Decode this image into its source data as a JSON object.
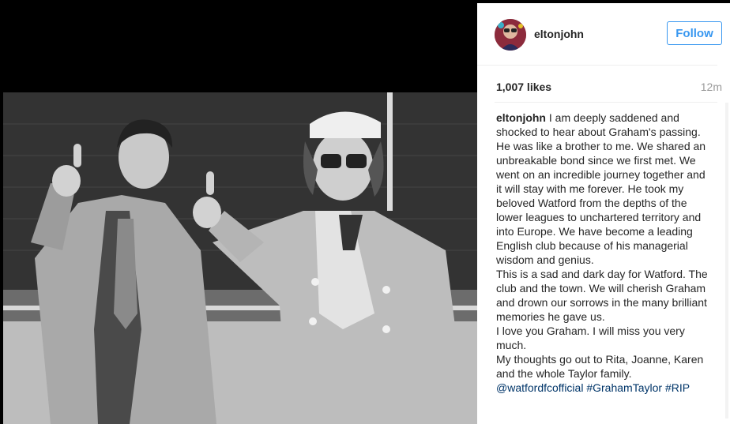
{
  "post": {
    "username": "eltonjohn",
    "follow_label": "Follow",
    "likes": "1,007 likes",
    "time_ago": "12m",
    "caption_lines": [
      "I am deeply saddened and shocked to hear about Graham's passing.",
      "He was like a brother to me. We shared an unbreakable bond since we first met. We went on an incredible journey together and it will stay with me forever. He took my beloved Watford from the depths of the lower leagues to unchartered territory and into Europe. We have become a leading English club because of his managerial wisdom and genius.",
      "This is a sad and dark day for Watford. The club and the town. We will cherish Graham and drown our sorrows in the many brilliant memories he gave us.",
      "I love you Graham. I will miss you very much.",
      "My thoughts go out to Rita, Joanne, Karen and the whole Taylor family."
    ],
    "mention": "@watfordfcofficial",
    "hashtags": [
      "#GrahamTaylor",
      "#RIP"
    ]
  },
  "colors": {
    "accent": "#3897f0",
    "link": "#003569",
    "text": "#262626",
    "muted": "#999999"
  }
}
